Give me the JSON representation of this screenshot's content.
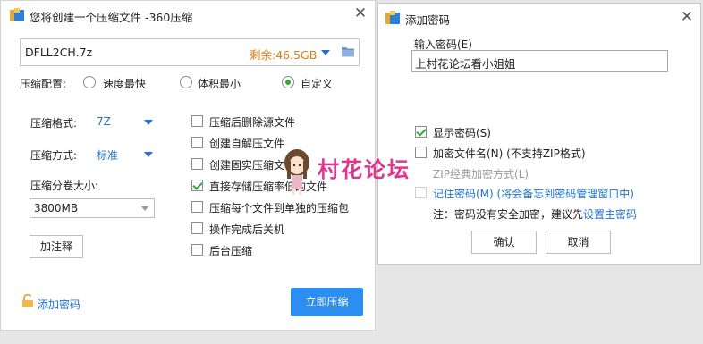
{
  "compress_dialog": {
    "title": "您将创建一个压缩文件 -360压缩",
    "filename": "DFLL2CH.7z",
    "free_space": "剩余:46.5GB",
    "config_label": "压缩配置:",
    "radio_options": [
      "速度最快",
      "体积最小",
      "自定义"
    ],
    "selected_radio": "自定义",
    "format_label": "压缩格式:",
    "format_value": "7Z",
    "method_label": "压缩方式:",
    "method_value": "标准",
    "volume_label": "压缩分卷大小:",
    "volume_value": "3800MB",
    "comment_button": "加注释",
    "options": [
      {
        "label": "压缩后删除源文件",
        "checked": false
      },
      {
        "label": "创建自解压文件",
        "checked": false
      },
      {
        "label": "创建固实压缩文件",
        "checked": false
      },
      {
        "label": "直接存储压缩率低的文件",
        "checked": true
      },
      {
        "label": "压缩每个文件到单独的压缩包",
        "checked": false
      },
      {
        "label": "操作完成后关机",
        "checked": false
      },
      {
        "label": "后台压缩",
        "checked": false
      }
    ],
    "add_password_link": "添加密码",
    "compress_button": "立即压缩"
  },
  "password_dialog": {
    "title": "添加密码",
    "input_label": "输入密码(E)",
    "password_value": "上村花论坛看小姐姐",
    "show_password": "显示密码(S)",
    "encrypt_names": "加密文件名(N) (不支持ZIP格式)",
    "zip_classic": "ZIP经典加密方式(L)",
    "remember_password": "记住密码(M) (将会备忘到密码管理窗口中)",
    "note_prefix": "注：密码没有安全加密，建议先",
    "note_link": "设置主密码",
    "ok_button": "确认",
    "cancel_button": "取消"
  },
  "watermark": {
    "text": "村花论坛"
  },
  "colors": {
    "accent": "#1f73d0",
    "primary_button": "#2b8ef0",
    "free_space": "#e07b12",
    "check_green": "#2faa38",
    "watermark_pink": "#e0358f"
  },
  "icons": {
    "app": "360zip-icon",
    "folder": "folder-icon",
    "lock": "lock-icon",
    "close": "close-icon"
  }
}
